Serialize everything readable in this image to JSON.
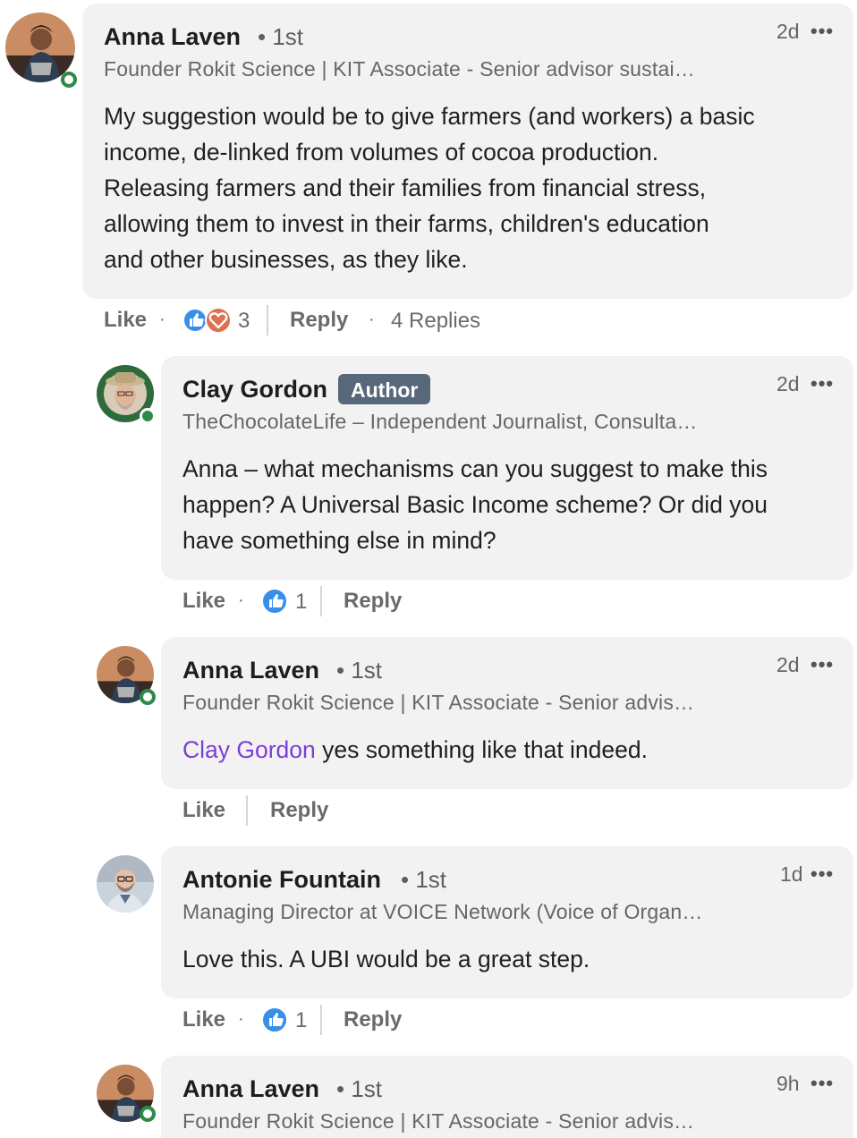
{
  "comments": [
    {
      "author": "Anna Laven",
      "degree": "• 1st",
      "headline": "Founder Rokit Science | KIT Associate - Senior advisor sustai…",
      "time": "2d",
      "more": "•••",
      "body_lines": [
        "My suggestion would be to give farmers (and workers) a basic",
        "income, de-linked from volumes of cocoa production.",
        "Releasing farmers and their families from financial stress,",
        "allowing them to invest in their farms, children's education",
        "and other businesses, as they like."
      ],
      "actions": {
        "like": "Like",
        "sep": "·",
        "reaction_count": "3",
        "reply": "Reply",
        "replies_sep": "·",
        "replies": "4 Replies"
      },
      "reactions": [
        "like-icon",
        "love-icon"
      ]
    },
    {
      "author": "Clay Gordon",
      "badge": "Author",
      "headline": "TheChocolateLife – Independent Journalist, Consulta…",
      "time": "2d",
      "more": "•••",
      "body_lines": [
        "Anna – what mechanisms can you suggest to make this",
        "happen? A Universal Basic Income scheme? Or did you",
        "have something else in mind?"
      ],
      "actions": {
        "like": "Like",
        "sep": "·",
        "reaction_count": "1",
        "reply": "Reply"
      },
      "reactions": [
        "like-icon"
      ]
    },
    {
      "author": "Anna Laven",
      "degree": "• 1st",
      "headline": "Founder Rokit Science | KIT Associate - Senior advis…",
      "time": "2d",
      "more": "•••",
      "mention": "Clay Gordon",
      "body_rest": " yes something like that indeed.",
      "actions": {
        "like": "Like",
        "reply": "Reply"
      }
    },
    {
      "author": "Antonie Fountain",
      "degree": "• 1st",
      "headline": "Managing Director at VOICE Network (Voice of Organ…",
      "time": "1d",
      "more": "•••",
      "body_lines": [
        "Love this. A UBI would be a great step."
      ],
      "actions": {
        "like": "Like",
        "sep": "·",
        "reaction_count": "1",
        "reply": "Reply"
      },
      "reactions": [
        "like-icon"
      ]
    },
    {
      "author": "Anna Laven",
      "degree": "• 1st",
      "headline": "Founder Rokit Science | KIT Associate - Senior advis…",
      "time": "9h",
      "more": "•••"
    }
  ],
  "colors": {
    "bubble": "#f2f2f2",
    "mention": "#7b3fd6",
    "online": "#2f8a47",
    "author_badge": "#56687a",
    "like_blue": "#378fe9",
    "love_red": "#df704d"
  }
}
